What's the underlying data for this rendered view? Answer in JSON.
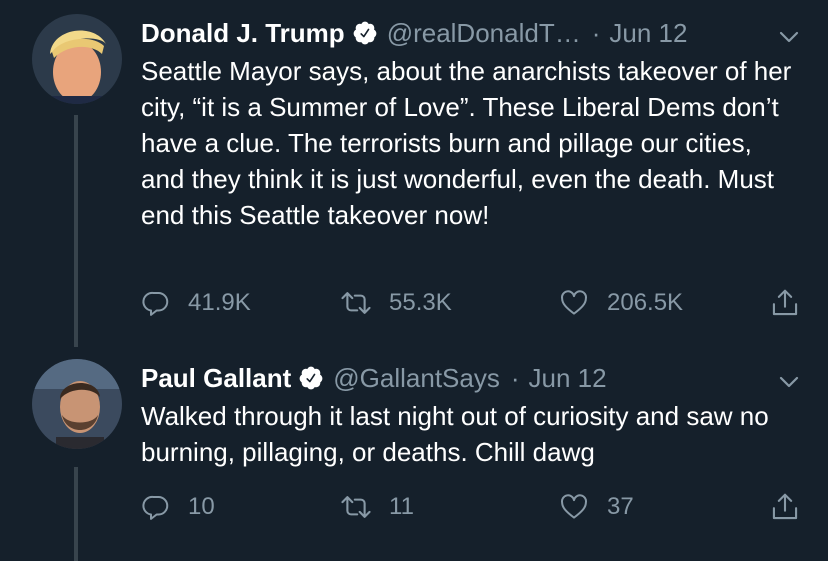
{
  "colors": {
    "background": "#15202b",
    "text_primary": "#ffffff",
    "text_secondary": "#8899a6",
    "verified_badge": "#ffffff",
    "thread_line": "#38444d"
  },
  "tweets": [
    {
      "author_name": "Donald J. Trump",
      "handle": "@realDonaldT…",
      "separator": "·",
      "date": "Jun 12",
      "text": "Seattle Mayor says, about the anarchists takeover of her city, “it is a Summer of Love”. These Liberal Dems don’t have a clue. The terrorists burn and pillage our cities, and they think it is just wonderful, even the death. Must end this Seattle takeover now!",
      "replies": "41.9K",
      "retweets": "55.3K",
      "likes": "206.5K",
      "icons": [
        "verified-icon",
        "chevron-down-icon",
        "reply-icon",
        "retweet-icon",
        "like-icon",
        "share-icon"
      ]
    },
    {
      "author_name": "Paul Gallant",
      "handle": "@GallantSays",
      "separator": "·",
      "date": "Jun 12",
      "text": "Walked through it last night out of curiosity and saw no burning, pillaging, or deaths. Chill dawg",
      "replies": "10",
      "retweets": "11",
      "likes": "37",
      "icons": [
        "verified-icon",
        "chevron-down-icon",
        "reply-icon",
        "retweet-icon",
        "like-icon",
        "share-icon"
      ]
    }
  ]
}
